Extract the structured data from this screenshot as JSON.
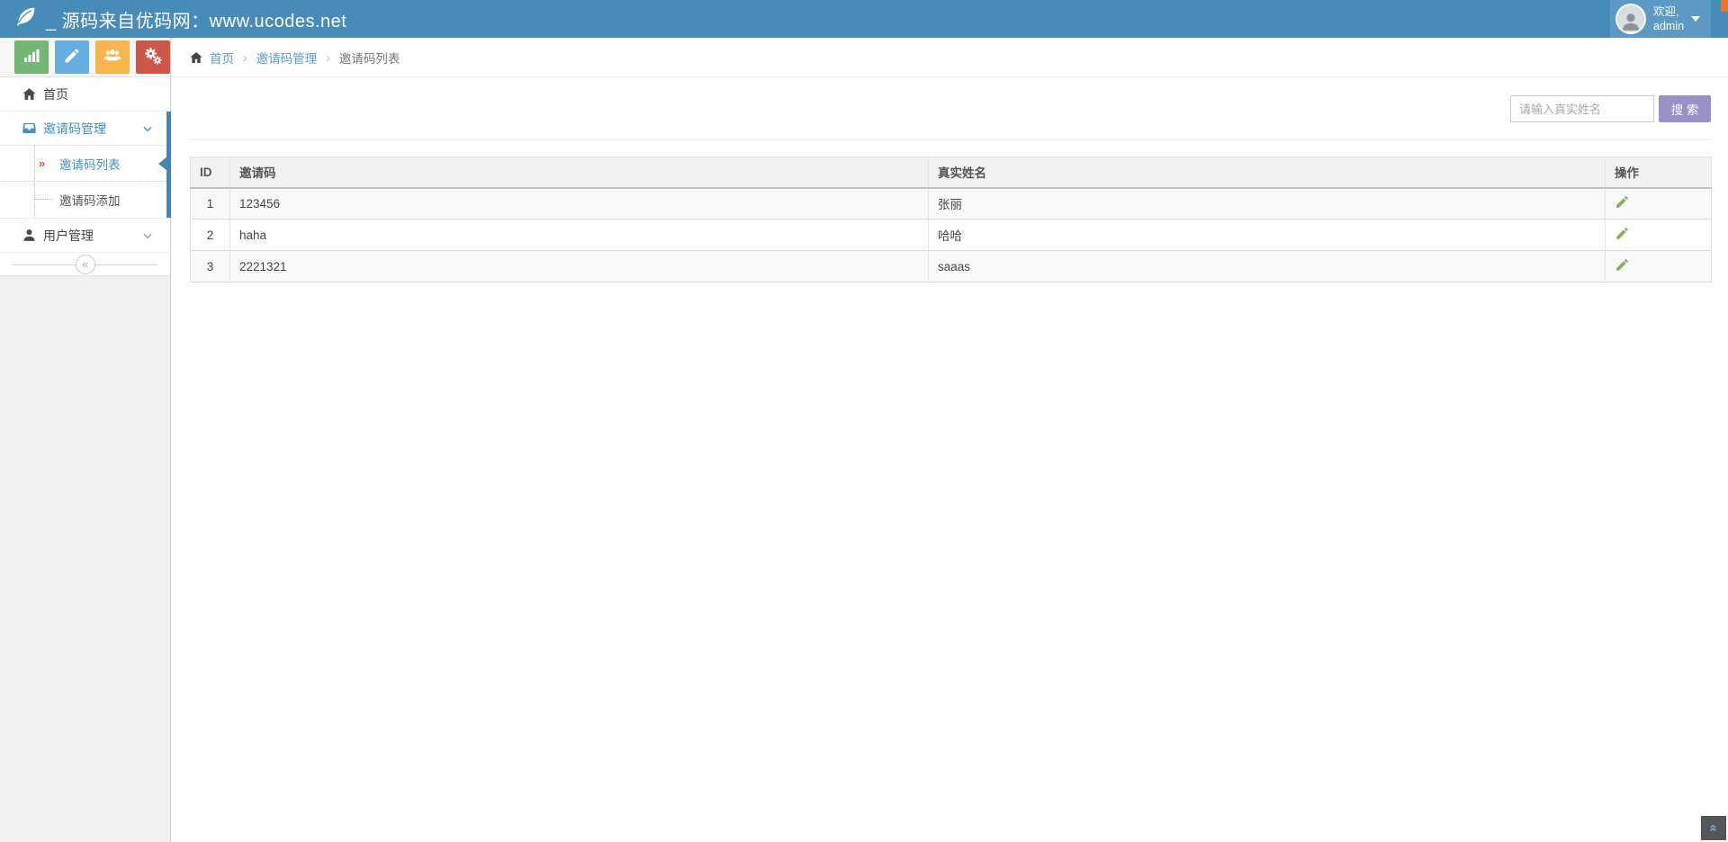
{
  "header": {
    "title": "_ 源码来自优码网：www.ucodes.net",
    "user": {
      "welcome": "欢迎,",
      "name": "admin"
    }
  },
  "toolbar": {
    "buttons": [
      {
        "name": "stats",
        "icon": "bar-chart-icon",
        "color": "#74b774"
      },
      {
        "name": "edit",
        "icon": "pencil-icon",
        "color": "#64aee4"
      },
      {
        "name": "users",
        "icon": "users-icon",
        "color": "#f7b64d"
      },
      {
        "name": "settings",
        "icon": "cogs-icon",
        "color": "#cf5749"
      }
    ]
  },
  "breadcrumb": {
    "separator": "›",
    "items": [
      {
        "label": "首页"
      },
      {
        "label": "邀请码管理"
      },
      {
        "label": "邀请码列表"
      }
    ]
  },
  "sidebar": {
    "items": [
      {
        "label": "首页"
      },
      {
        "label": "邀请码管理"
      },
      {
        "label": "邀请码列表"
      },
      {
        "label": "邀请码添加"
      },
      {
        "label": "用户管理"
      }
    ],
    "submenu_marker": "»",
    "collapse_glyph": "«"
  },
  "search": {
    "placeholder": "请输入真实姓名",
    "button_label": "搜 索"
  },
  "table": {
    "columns": [
      "ID",
      "邀请码",
      "真实姓名",
      "操作"
    ],
    "rows": [
      {
        "id": "1",
        "code": "123456",
        "name": "张丽"
      },
      {
        "id": "2",
        "code": "haha",
        "name": "哈哈"
      },
      {
        "id": "3",
        "code": "2221321",
        "name": "saaas"
      }
    ]
  },
  "back_to_top_glyph": "«",
  "colors": {
    "header_bg": "#478bb8",
    "user_panel_bg": "#5c9ac4",
    "accent_blue": "#4287b5",
    "link_blue": "#5a9ace",
    "active_menu_blue": "#4191c3",
    "search_button_bg": "#9b90c6",
    "corner_accent_orange": "#ec7625",
    "pencil_green": "#85b05c",
    "submenu_marker_red": "#cf5749"
  }
}
